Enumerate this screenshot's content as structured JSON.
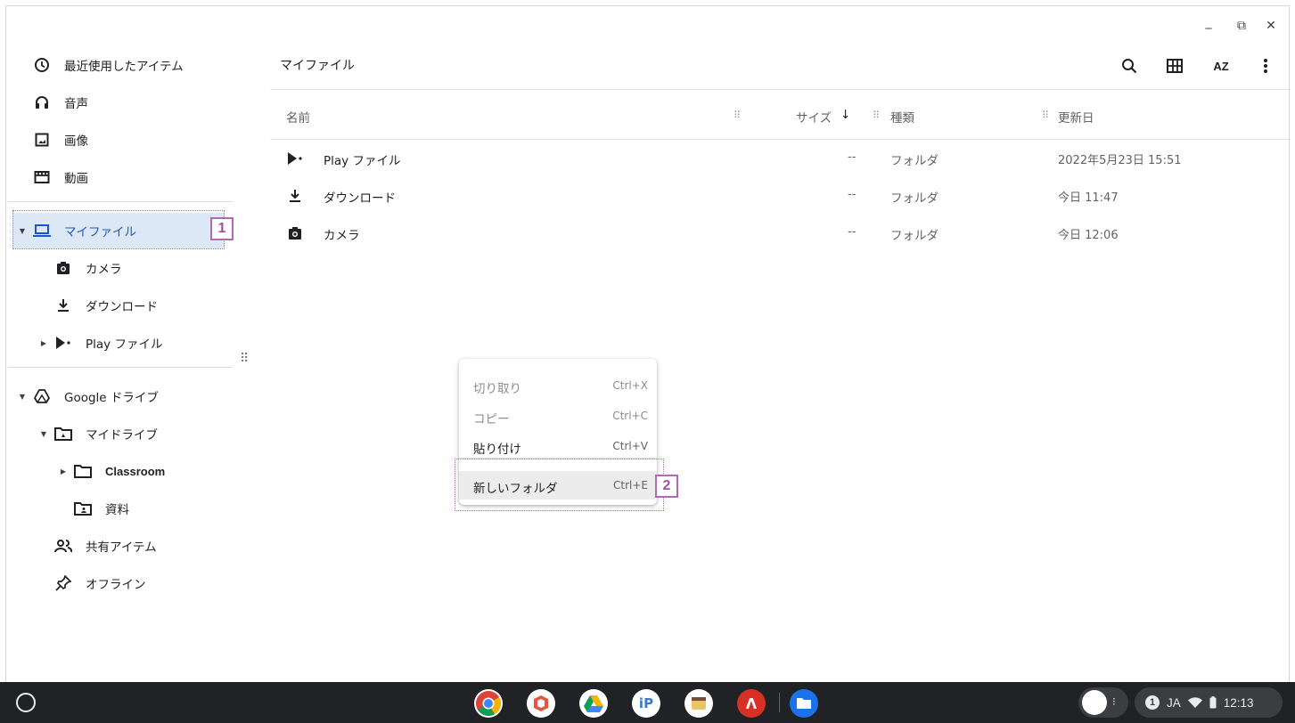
{
  "window": {
    "controls": {
      "minimize": "_",
      "restore": "⧉",
      "close": "✕"
    }
  },
  "sidebar": {
    "recent": {
      "label": "最近使用したアイテム"
    },
    "audio": {
      "label": "音声"
    },
    "images": {
      "label": "画像"
    },
    "videos": {
      "label": "動画"
    },
    "my_files": {
      "label": "マイファイル"
    },
    "camera": {
      "label": "カメラ"
    },
    "downloads": {
      "label": "ダウンロード"
    },
    "play_files": {
      "label": "Play ファイル"
    },
    "google_drive": {
      "label": "Google ドライブ"
    },
    "my_drive": {
      "label": "マイドライブ"
    },
    "classroom": {
      "label": "Classroom"
    },
    "materials": {
      "label": "資料"
    },
    "shared": {
      "label": "共有アイテム"
    },
    "offline": {
      "label": "オフライン"
    }
  },
  "callouts": {
    "one": "1",
    "two": "2"
  },
  "main": {
    "breadcrumb": "マイファイル",
    "toolbar_icons": [
      "search-icon",
      "grid-view-icon",
      "sort-az-icon",
      "more-vert-icon"
    ],
    "sort_label": "AZ",
    "columns": {
      "name": "名前",
      "size": "サイズ",
      "type": "種類",
      "modified": "更新日"
    },
    "rows": [
      {
        "icon": "play-files-icon",
        "name": "Play ファイル",
        "size": "--",
        "type": "フォルダ",
        "modified": "2022年5月23日 15:51"
      },
      {
        "icon": "download-icon",
        "name": "ダウンロード",
        "size": "--",
        "type": "フォルダ",
        "modified": "今日 11:47"
      },
      {
        "icon": "camera-icon",
        "name": "カメラ",
        "size": "--",
        "type": "フォルダ",
        "modified": "今日 12:06"
      }
    ]
  },
  "context_menu": {
    "cut": {
      "label": "切り取り",
      "shortcut": "Ctrl+X"
    },
    "copy": {
      "label": "コピー",
      "shortcut": "Ctrl+C"
    },
    "paste": {
      "label": "貼り付け",
      "shortcut": "Ctrl+V"
    },
    "new_folder": {
      "label": "新しいフォルダ",
      "shortcut": "Ctrl+E"
    }
  },
  "shelf": {
    "apps": [
      "chrome-icon",
      "office-icon",
      "google-drive-icon",
      "ibis-paint-icon",
      "app-icon",
      "acrobat-icon",
      "files-icon"
    ],
    "notification_count": "1",
    "ime": "JA",
    "time": "12:13"
  },
  "colors": {
    "selected": "#dde8f6",
    "callout": "#b06ab3",
    "shelf": "#212225"
  }
}
